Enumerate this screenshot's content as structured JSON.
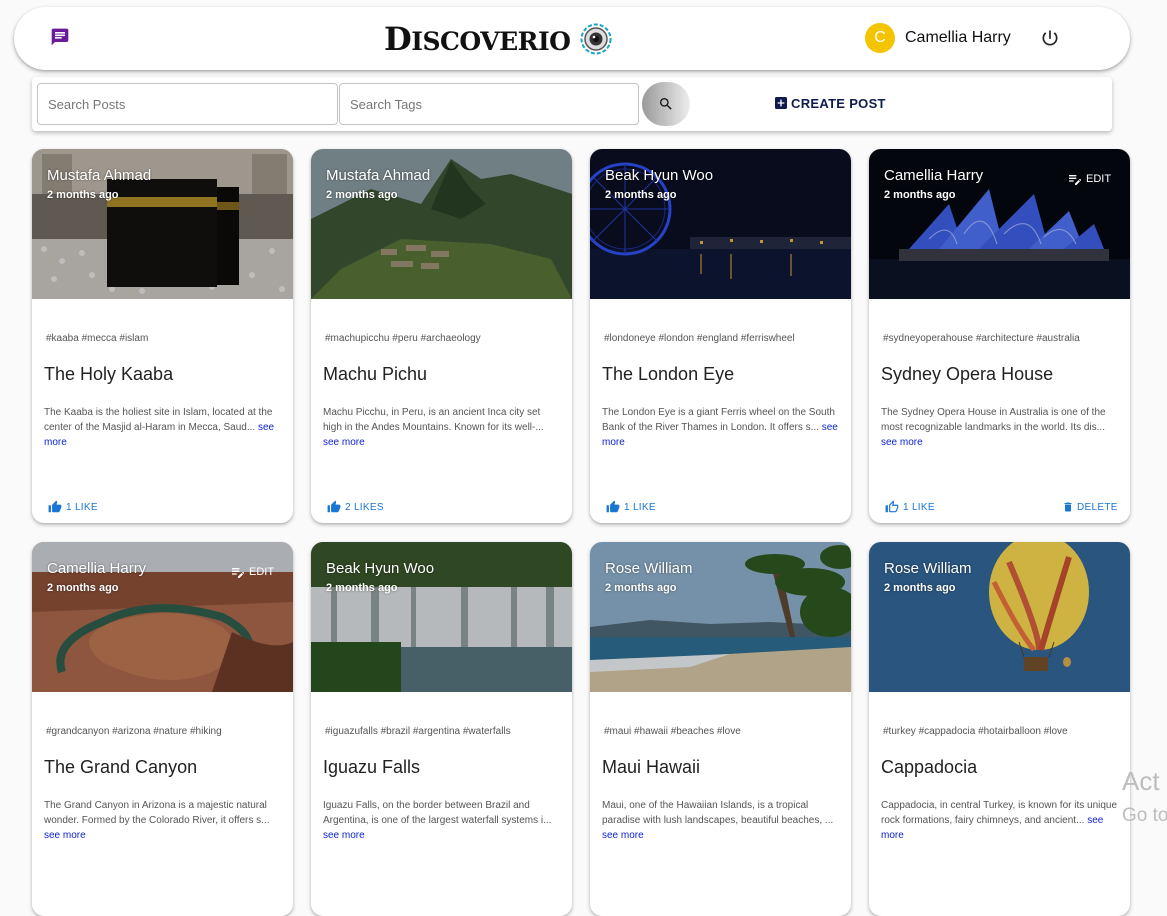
{
  "header": {
    "brand": "DISCOVERIO",
    "user": {
      "initial": "C",
      "name": "Camellia Harry"
    }
  },
  "search": {
    "posts_placeholder": "Search Posts",
    "tags_placeholder": "Search Tags",
    "create_label": "CREATE POST"
  },
  "cards": [
    {
      "author": "Mustafa Ahmad",
      "time": "2 months ago",
      "tags": "#kaaba #mecca #islam",
      "title": "The Holy Kaaba",
      "desc": "The Kaaba is the holiest site in Islam, located at the center of the Masjid al-Haram in Mecca, Saud...",
      "see_more": "see more",
      "likes": "1 LIKE",
      "liked": true,
      "own": false
    },
    {
      "author": "Mustafa Ahmad",
      "time": "2 months ago",
      "tags": "#machupicchu #peru #archaeology",
      "title": "Machu Pichu",
      "desc": "Machu Picchu, in Peru, is an ancient Inca city set high in the Andes Mountains. Known for its well-...",
      "see_more": "see more",
      "likes": "2 LIKES",
      "liked": true,
      "own": false
    },
    {
      "author": "Beak Hyun Woo",
      "time": "2 months ago",
      "tags": "#londoneye #london #england #ferriswheel",
      "title": "The London Eye",
      "desc": "The London Eye is a giant Ferris wheel on the South Bank of the River Thames in London. It offers s...",
      "see_more": "see more",
      "likes": "1 LIKE",
      "liked": true,
      "own": false
    },
    {
      "author": "Camellia Harry",
      "time": "2 months ago",
      "tags": "#sydneyoperahouse #architecture #australia",
      "title": "Sydney Opera House",
      "desc": "The Sydney Opera House in Australia is one of the most recognizable landmarks in the world. Its dis...",
      "see_more": "see more",
      "likes": "1 LIKE",
      "liked": false,
      "own": true,
      "edit": "EDIT",
      "delete": "DELETE"
    },
    {
      "author": "Camellia Harry",
      "time": "2 months ago",
      "tags": "#grandcanyon #arizona #nature #hiking",
      "title": "The Grand Canyon",
      "desc": "The Grand Canyon in Arizona is a majestic natural wonder. Formed by the Colorado River, it offers s...",
      "see_more": "see more",
      "own": true,
      "edit": "EDIT"
    },
    {
      "author": "Beak Hyun Woo",
      "time": "2 months ago",
      "tags": "#iguazufalls #brazil #argentina #waterfalls",
      "title": "Iguazu Falls",
      "desc": "Iguazu Falls, on the border between Brazil and Argentina, is one of the largest waterfall systems i...",
      "see_more": "see more",
      "own": false
    },
    {
      "author": "Rose William",
      "time": "2 months ago",
      "tags": "#maui #hawaii #beaches #love",
      "title": "Maui Hawaii",
      "desc": "Maui, one of the Hawaiian Islands, is a tropical paradise with lush landscapes, beautiful beaches, ...",
      "see_more": "see more",
      "own": false
    },
    {
      "author": "Rose William",
      "time": "2 months ago",
      "tags": "#turkey #cappadocia #hotairballoon #love",
      "title": "Cappadocia",
      "desc": "Cappadocia, in central Turkey, is known for its unique rock formations, fairy chimneys, and ancient...",
      "see_more": "see more",
      "own": false
    }
  ],
  "watermark": {
    "line1": "Act",
    "line2": "Go to"
  },
  "colors": {
    "accent": "#1976d2",
    "avatar": "#f5c400",
    "create": "#0f1b4d",
    "chat_icon": "#6a1b9a"
  }
}
